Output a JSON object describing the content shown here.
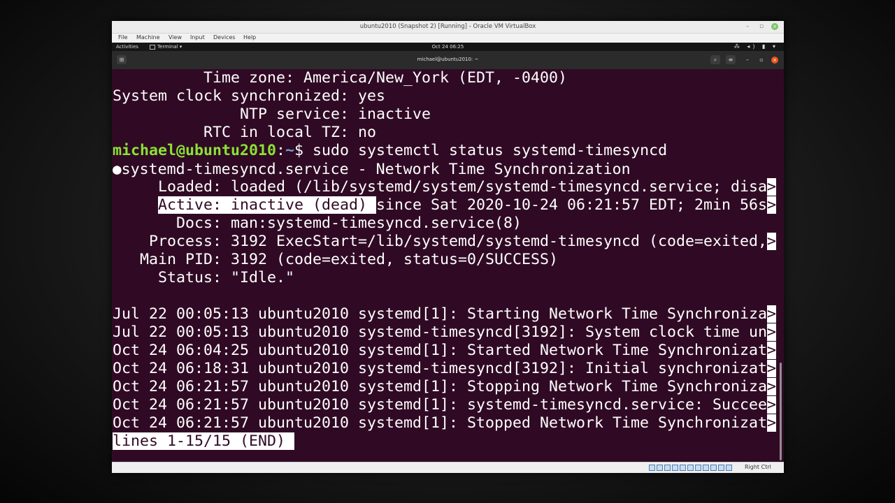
{
  "vbox": {
    "title": "ubuntu2010 (Snapshot 2) [Running] - Oracle VM VirtualBox",
    "menu": [
      "File",
      "Machine",
      "View",
      "Input",
      "Devices",
      "Help"
    ],
    "host_key": "Right Ctrl"
  },
  "gnome": {
    "activities": "Activities",
    "app": "Terminal ▾",
    "clock": "Oct 24  06:25",
    "tray": "⁂ ◂) ▮ ▾"
  },
  "terminal": {
    "title": "michael@ubuntu2010: ~",
    "lines": {
      "time_zone": "          Time zone: America/New_York (EDT, -0400)",
      "clock_sync": "System clock synchronized: yes",
      "ntp": "              NTP service: inactive",
      "rtc": "          RTC in local TZ: no",
      "prompt_user": "michael@ubuntu2010",
      "prompt_sep": ":",
      "prompt_path": "~",
      "prompt_cmd": "$ sudo systemctl status systemd-timesyncd",
      "unit_dot": "●",
      "unit_title": "systemd-timesyncd.service - Network Time Synchronization",
      "loaded": "     Loaded: loaded (/lib/systemd/system/systemd-timesyncd.service; disa",
      "active_indent": "     ",
      "active_hl": "Active: inactive (dead) ",
      "active_rest": "since Sat 2020-10-24 06:21:57 EDT; 2min 56s",
      "docs": "       Docs: man:systemd-timesyncd.service(8)",
      "process": "    Process: 3192 ExecStart=/lib/systemd/systemd-timesyncd (code=exited,",
      "main_pid": "   Main PID: 3192 (code=exited, status=0/SUCCESS)",
      "status": "     Status: \"Idle.\"",
      "log1": "Jul 22 00:05:13 ubuntu2010 systemd[1]: Starting Network Time Synchroniza",
      "log2": "Jul 22 00:05:13 ubuntu2010 systemd-timesyncd[3192]: System clock time un",
      "log3": "Oct 24 06:04:25 ubuntu2010 systemd[1]: Started Network Time Synchronizat",
      "log4": "Oct 24 06:18:31 ubuntu2010 systemd-timesyncd[3192]: Initial synchronizat",
      "log5": "Oct 24 06:21:57 ubuntu2010 systemd[1]: Stopping Network Time Synchroniza",
      "log6": "Oct 24 06:21:57 ubuntu2010 systemd[1]: systemd-timesyncd.service: Succee",
      "log7": "Oct 24 06:21:57 ubuntu2010 systemd[1]: Stopped Network Time Synchronizat",
      "truncate": ">",
      "pager": "lines 1-15/15 (END) "
    }
  },
  "colors": {
    "terminal_bg": "#300a24",
    "prompt_user": "#8ae234",
    "prompt_path": "#729fcf",
    "ubuntu_orange": "#e95420"
  }
}
